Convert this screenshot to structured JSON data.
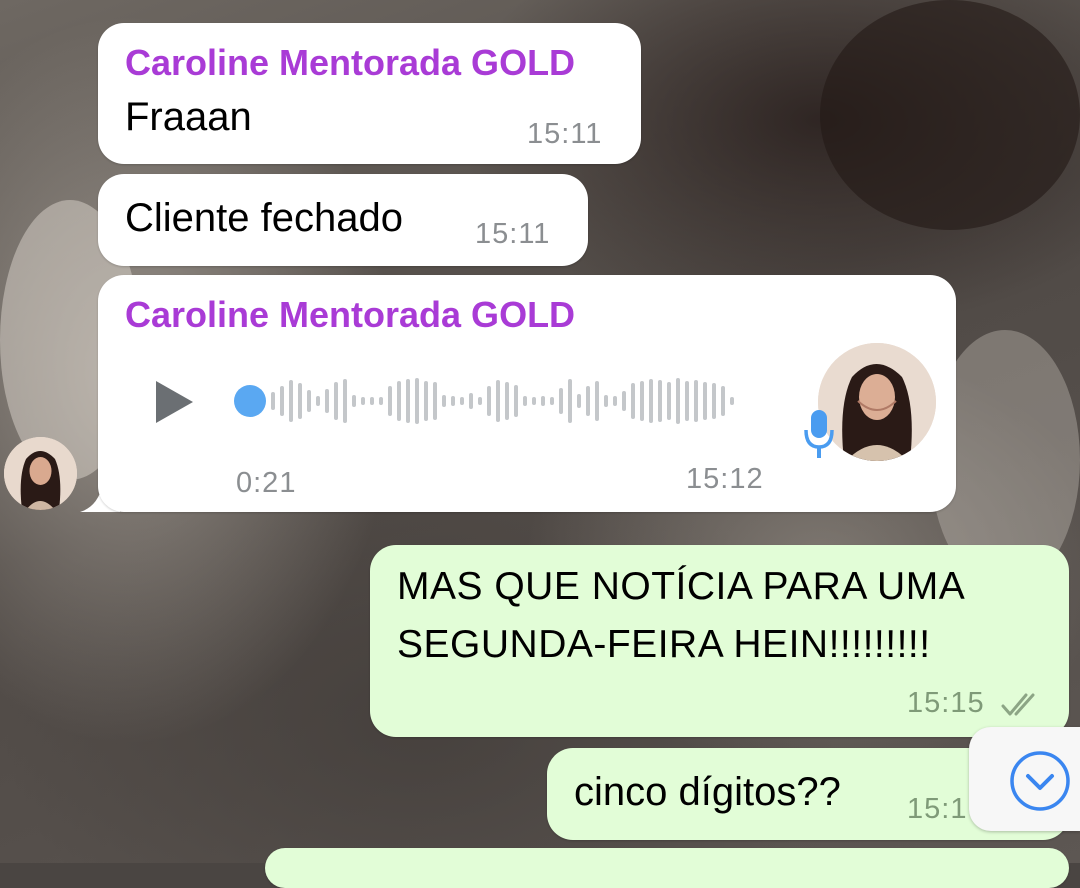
{
  "messages": [
    {
      "sender": "Caroline Mentorada GOLD",
      "text": "Fraaan",
      "time": "15:11"
    },
    {
      "text": "Cliente fechado",
      "time": "15:11"
    },
    {
      "sender": "Caroline Mentorada GOLD",
      "voice_duration": "0:21",
      "time": "15:12"
    },
    {
      "text_line1": "MAS QUE NOTÍCIA PARA UMA",
      "text_line2": "SEGUNDA-FEIRA HEIN!!!!!!!!!",
      "time": "15:15"
    },
    {
      "text": "cinco dígitos??",
      "time": "15:1"
    }
  ],
  "colors": {
    "sender": "#a93bd6",
    "incoming_bubble": "#ffffff",
    "outgoing_bubble": "#e2fdd7",
    "accent": "#3a86f0"
  },
  "icons": {
    "play": "play-icon",
    "microphone": "microphone-icon",
    "read_receipt": "double-check-icon",
    "scroll_down": "chevron-down-icon"
  }
}
